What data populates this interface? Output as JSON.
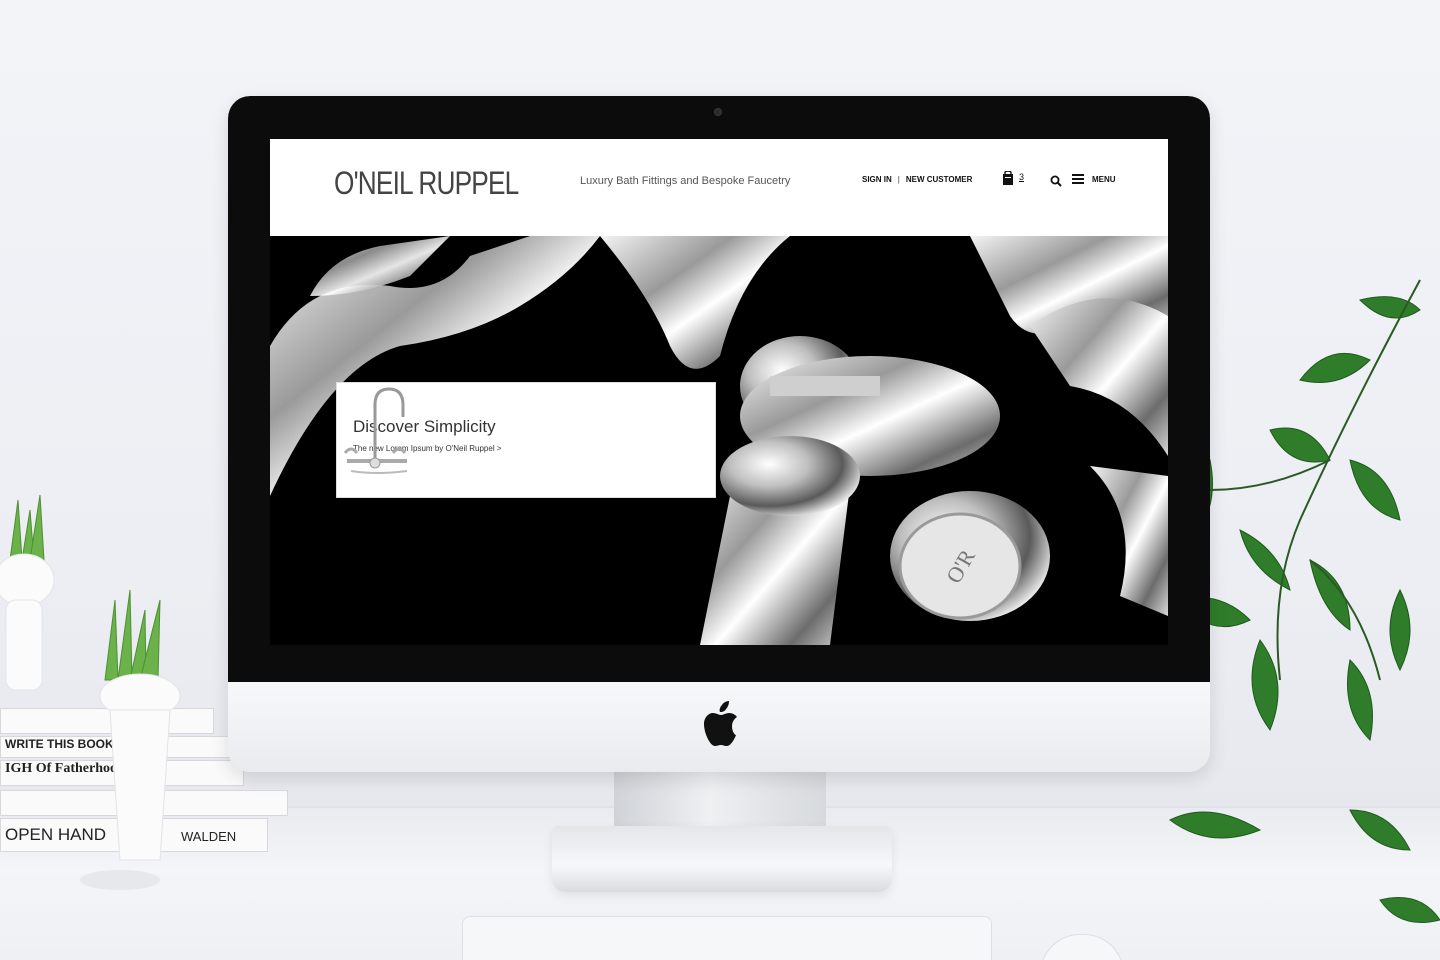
{
  "site": {
    "brand": "O'NEIL RUPPEL",
    "tagline": "Luxury Bath Fittings and Bespoke Faucetry",
    "nav": {
      "sign_in": "SIGN IN",
      "separator": "|",
      "new_customer": "NEW CUSTOMER",
      "cart_count": "3",
      "menu_label": "MENU"
    },
    "hero": {
      "promo_title": "Discover Simplicity",
      "promo_subtitle": "The new Lorem Ipsum by O'Neil Ruppel >"
    }
  },
  "scene": {
    "books": [
      "WRITE THIS BOOK",
      "IGH Of Fatherhoo",
      "OPEN HAND",
      "WALDEN"
    ],
    "icons": [
      "cart-icon",
      "search-icon",
      "hamburger-icon",
      "apple-logo-icon",
      "camera-icon"
    ]
  },
  "colors": {
    "header_bg": "#ffffff",
    "hero_bg": "#000000",
    "text_dark": "#111111",
    "plant_green": "#2f7d2a"
  }
}
